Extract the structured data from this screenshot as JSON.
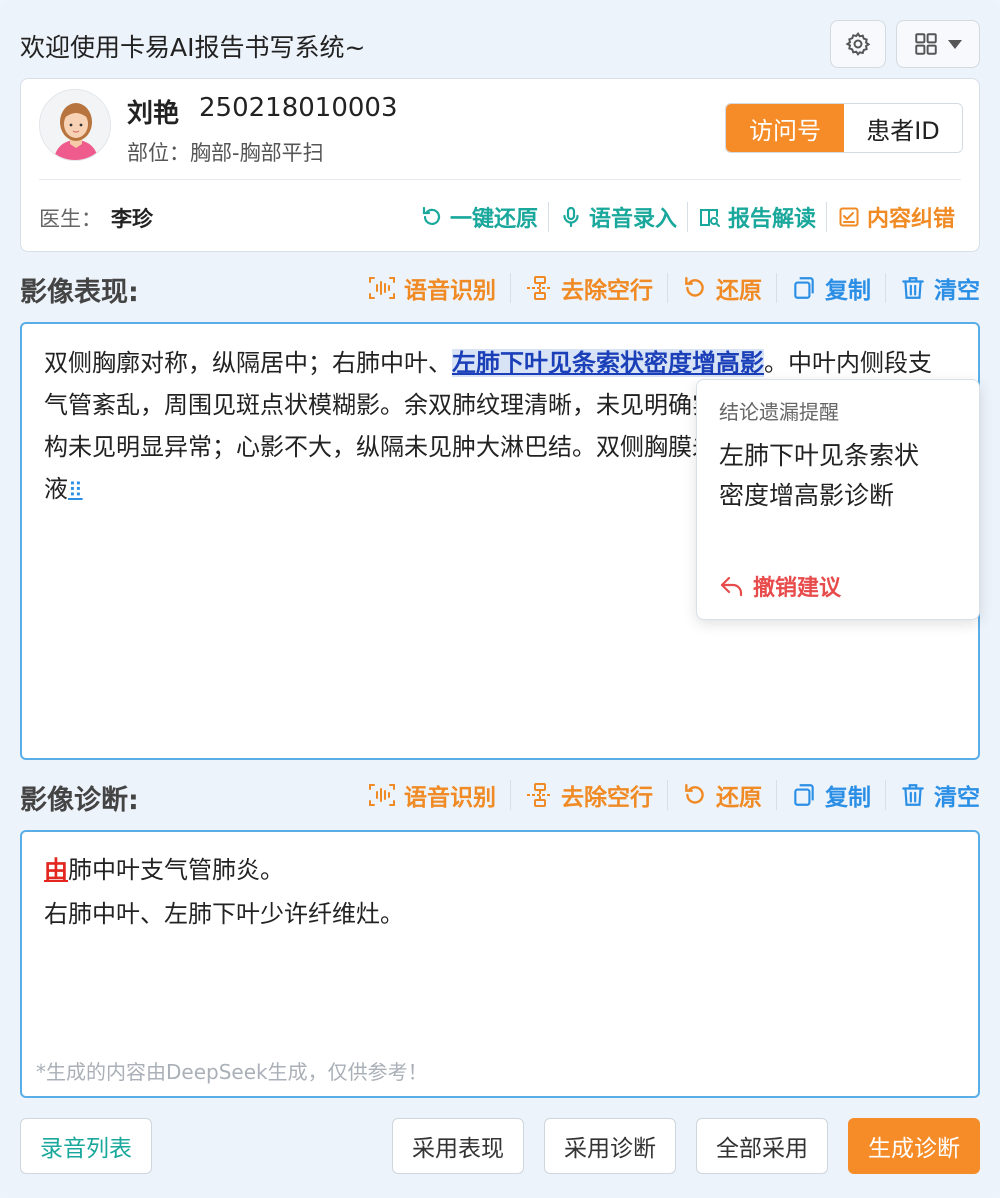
{
  "header": {
    "title": "欢迎使用卡易AI报告书写系统~",
    "settings_icon": "gear-icon",
    "layout_icon": "grid-icon"
  },
  "patient": {
    "name": "刘艳",
    "id": "250218010003",
    "part": "部位：胸部-胸部平扫",
    "toggle": {
      "visit": "访问号",
      "patient_id": "患者ID"
    },
    "doctor_label": "医生：",
    "doctor_name": "李珍",
    "actions": [
      {
        "label": "一键还原",
        "icon": "undo-icon"
      },
      {
        "label": "语音录入",
        "icon": "microphone-icon"
      },
      {
        "label": "报告解读",
        "icon": "document-search-icon"
      },
      {
        "label": "内容纠错",
        "icon": "checklist-icon"
      }
    ]
  },
  "findings": {
    "title": "影像表现:",
    "text_before": "双侧胸廓对称，纵隔居中；右肺中叶、",
    "text_highlight": "左肺下叶见条索状密度增高影",
    "text_after": "。中叶内侧段支气管紊乱，周围见斑点状模糊影。余双肺纹理清晰，未见明确实质性病灶，双肺门结构未见明显异常；心影不大，纵隔未见肿大淋巴结。双侧胸膜未见增厚，胸腔未见积液",
    "drag_handle": "⠿"
  },
  "toolbar": {
    "voice_recognition": "语音识别",
    "remove_blank_lines": "去除空行",
    "restore": "还原",
    "copy": "复制",
    "clear": "清空"
  },
  "popup": {
    "title": "结论遗漏提醒",
    "body": "左肺下叶见条索状密度增高影诊断",
    "action": "撤销建议"
  },
  "diagnosis": {
    "title": "影像诊断:",
    "line1_error": "由",
    "line1_rest": "肺中叶支气管肺炎。",
    "line2": "右肺中叶、左肺下叶少许纤维灶。",
    "disclaimer": "*生成的内容由DeepSeek生成，仅供参考！"
  },
  "footer": {
    "recording_list": "录音列表",
    "adopt_findings": "采用表现",
    "adopt_diagnosis": "采用诊断",
    "adopt_all": "全部采用",
    "generate_diagnosis": "生成诊断"
  },
  "colors": {
    "accent_orange": "#f68c28",
    "accent_green": "#1aa89c",
    "accent_blue": "#2b8fe6",
    "error_red": "#e3261f"
  }
}
